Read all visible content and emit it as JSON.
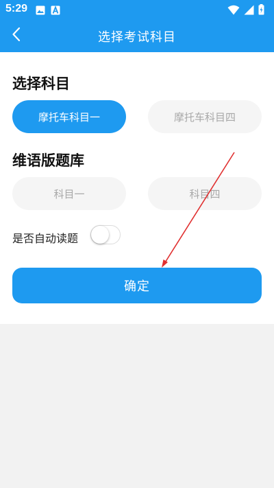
{
  "status_bar": {
    "time": "5:29",
    "icons": [
      "image-icon",
      "a-icon",
      "wifi-icon",
      "cellular-signal-icon",
      "battery-charging-icon"
    ]
  },
  "nav": {
    "title": "选择考试科目",
    "back_icon": "chevron-left-icon"
  },
  "section_subject": {
    "title": "选择科目",
    "options": [
      {
        "label": "摩托车科目一",
        "selected": true
      },
      {
        "label": "摩托车科目四",
        "selected": false
      }
    ]
  },
  "section_uyghur": {
    "title": "维语版题库",
    "options": [
      {
        "label": "科目一",
        "selected": false
      },
      {
        "label": "科目四",
        "selected": false
      }
    ]
  },
  "auto_read": {
    "label": "是否自动读题",
    "enabled": false
  },
  "confirm_button": {
    "label": "确定"
  },
  "colors": {
    "primary": "#1e9af0",
    "option_bg": "#f5f5f5",
    "option_text": "#a8a8a8",
    "page_bg": "#f2f2f2",
    "annotation_arrow": "#e03030"
  }
}
